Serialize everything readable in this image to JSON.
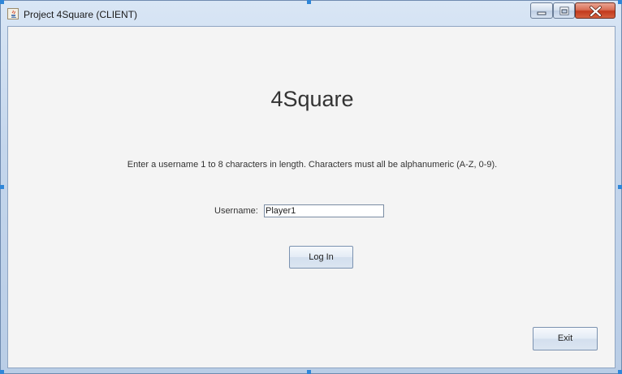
{
  "window": {
    "title": "Project 4Square (CLIENT)"
  },
  "main": {
    "heading": "4Square",
    "instruction": "Enter a username 1 to 8 characters in length. Characters must all be alphanumeric (A-Z, 0-9).",
    "username_label": "Username:",
    "username_value": "Player1",
    "login_label": "Log In",
    "exit_label": "Exit"
  },
  "icons": {
    "app": "java-icon",
    "minimize": "minimize-icon",
    "maximize": "maximize-icon",
    "close": "close-icon"
  },
  "colors": {
    "background": "#f4f4f4",
    "title_text": "#1b1b1b",
    "close_button": "#c2391c",
    "selection_handle": "#2f86d8"
  }
}
